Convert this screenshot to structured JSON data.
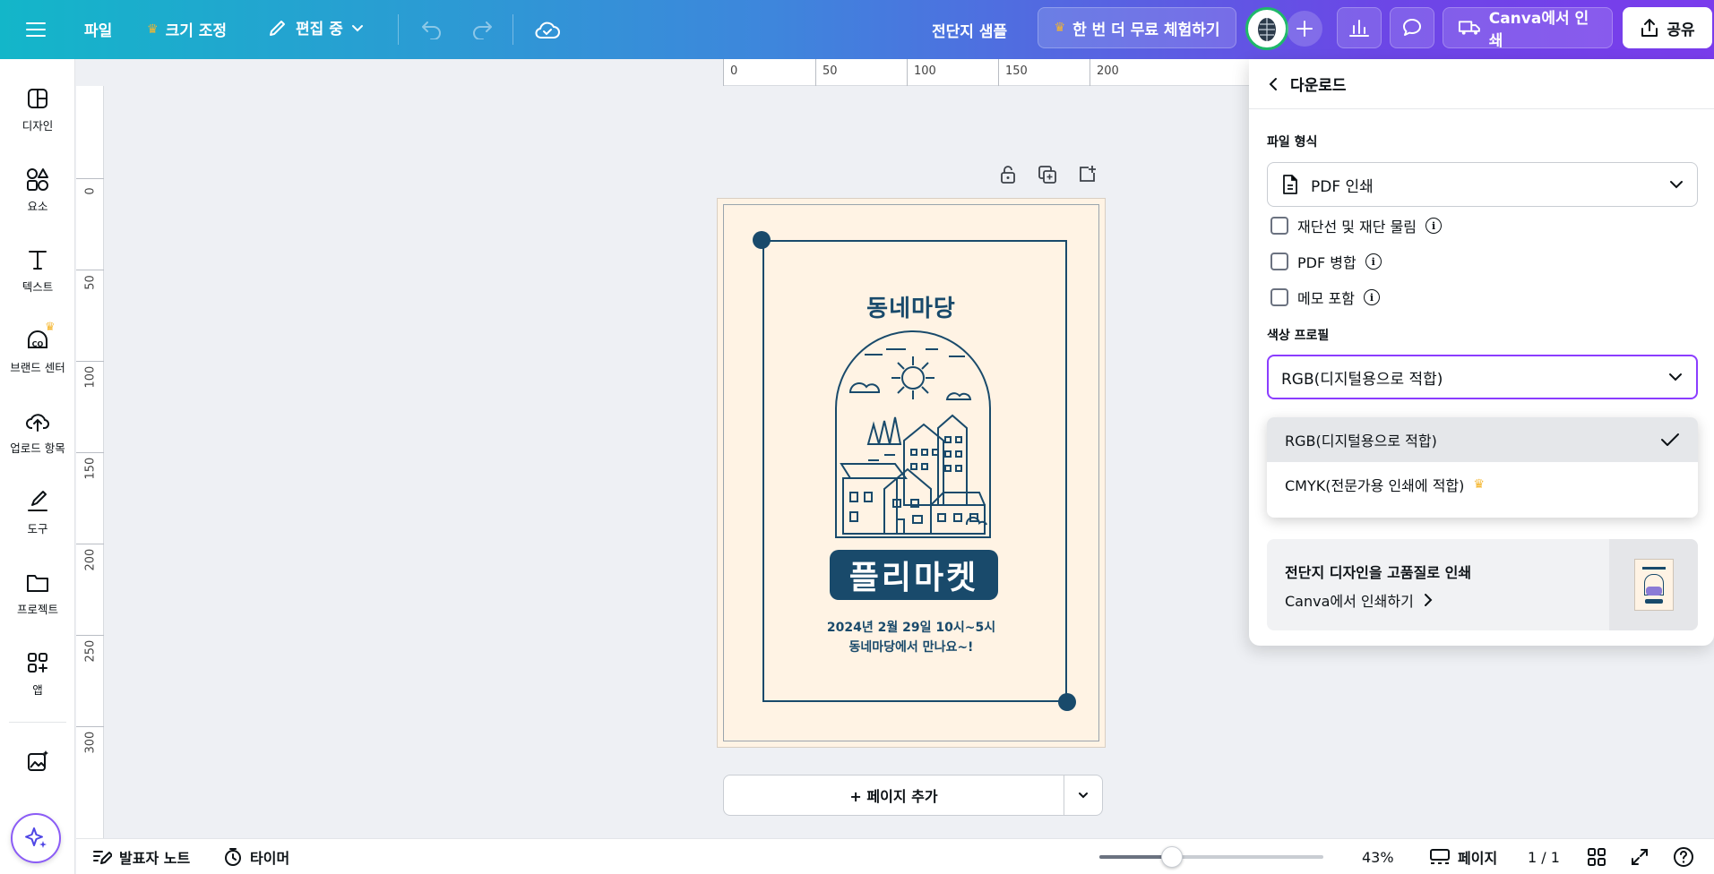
{
  "topbar": {
    "file_label": "파일",
    "resize_label": "크기 조정",
    "editing_label": "편집 중",
    "doc_title": "전단지 샘플",
    "trial_label": "한 번 더 무료 체험하기",
    "print_label": "Canva에서 인쇄",
    "share_label": "공유"
  },
  "sidebar": {
    "items": [
      {
        "label": "디자인",
        "icon": "design-icon"
      },
      {
        "label": "요소",
        "icon": "elements-icon"
      },
      {
        "label": "텍스트",
        "icon": "text-icon"
      },
      {
        "label": "브랜드 센터",
        "icon": "brand-icon"
      },
      {
        "label": "업로드 항목",
        "icon": "upload-icon"
      },
      {
        "label": "도구",
        "icon": "draw-icon"
      },
      {
        "label": "프로젝트",
        "icon": "folder-icon"
      },
      {
        "label": "앱",
        "icon": "apps-icon"
      }
    ]
  },
  "ruler": {
    "top": [
      "0",
      "50",
      "100",
      "150",
      "200"
    ],
    "left": [
      "0",
      "50",
      "100",
      "150",
      "200",
      "250",
      "300"
    ]
  },
  "poster": {
    "title": "동네마당",
    "headline": "플리마켓",
    "date_line": "2024년 2월 29일 10시~5시",
    "place_line": "동네마당에서 만나요~!",
    "colors": {
      "background": "#fff3e4",
      "ink": "#194a6b"
    }
  },
  "canvas": {
    "add_page_label": "+ 페이지 추가"
  },
  "bottombar": {
    "notes_label": "발표자 노트",
    "timer_label": "타이머",
    "zoom_percent": "43%",
    "zoom_value": 43,
    "pages_label": "페이지",
    "page_count": "1 / 1"
  },
  "download_panel": {
    "title": "다운로드",
    "file_type_label": "파일 형식",
    "file_type_value": "PDF 인쇄",
    "options": [
      {
        "label": "재단선 및 재단 물림",
        "checked": false
      },
      {
        "label": "PDF 병합",
        "checked": false
      },
      {
        "label": "메모 포함",
        "checked": false
      }
    ],
    "color_profile_label": "색상 프로필",
    "color_profile_value": "RGB(디지털용으로 적합)",
    "color_profile_options": [
      {
        "label": "RGB(디지털용으로 적합)",
        "selected": true
      },
      {
        "label": "CMYK(전문가용 인쇄에 적합)",
        "selected": false,
        "pro": true
      }
    ],
    "promo_title": "전단지 디자인을 고품질로 인쇄",
    "promo_link": "Canva에서 인쇄하기"
  },
  "colors": {
    "accent": "#8b3dff",
    "crown": "#f5b62e",
    "topbar_start": "#13b6c9",
    "topbar_end": "#7a3cec"
  }
}
